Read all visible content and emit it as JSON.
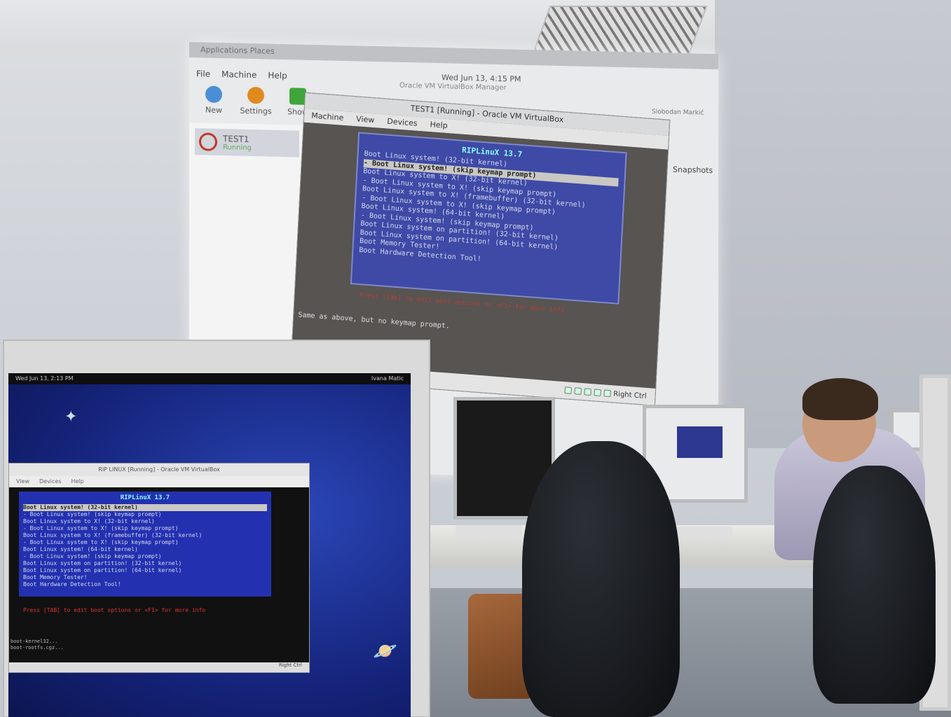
{
  "projection": {
    "topbar": "Applications   Places",
    "clock": "Wed Jun 13,  4:15 PM",
    "manager_title": "Oracle VM VirtualBox Manager",
    "user": "Slobodan Markić",
    "menu": [
      "File",
      "Machine",
      "Help"
    ],
    "toolbar": [
      {
        "label": "New",
        "color": "#4a8fd6"
      },
      {
        "label": "Settings",
        "color": "#e08a1e"
      },
      {
        "label": "Show",
        "color": "#3fa53a"
      }
    ],
    "vm_item": {
      "name": "TEST1",
      "state": "Running"
    },
    "snapshots_label": "Snapshots",
    "vm_window": {
      "title": "TEST1 [Running] - Oracle VM VirtualBox",
      "menu": [
        "Machine",
        "View",
        "Devices",
        "Help"
      ],
      "boot_title": "RIPLinuX 13.7",
      "boot_items": [
        "Boot Linux system! (32-bit kernel)",
        "- Boot Linux system! (skip keymap prompt)",
        "Boot Linux system to X! (32-bit kernel)",
        "- Boot Linux system to X! (skip keymap prompt)",
        "Boot Linux system to X! (framebuffer) (32-bit kernel)",
        "- Boot Linux system to X! (skip keymap prompt)",
        "Boot Linux system! (64-bit kernel)",
        "- Boot Linux system! (skip keymap prompt)",
        "Boot Linux system on partition! (32-bit kernel)",
        "Boot Linux system on partition! (64-bit kernel)",
        "Boot Memory Tester!",
        "Boot Hardware Detection Tool!"
      ],
      "selected_index": 1,
      "hint": "Press [Tab] to edit boot options or <F1> for more info",
      "description": "Same as above, but no keymap prompt.",
      "host_key": "Right Ctrl"
    }
  },
  "front_monitor": {
    "clock": "Wed Jun 13,  2:13 PM",
    "user": "Ivana Matic",
    "vm_title": "RIP LINUX [Running] - Oracle VM VirtualBox",
    "menu": [
      "View",
      "Devices",
      "Help"
    ],
    "boot_title": "RIPLinuX 13.7",
    "boot_items": [
      "Boot Linux system! (32-bit kernel)",
      "- Boot Linux system! (skip keymap prompt)",
      "Boot Linux system to X! (32-bit kernel)",
      "- Boot Linux system to X! (skip keymap prompt)",
      "Boot Linux system to X! (framebuffer) (32-bit kernel)",
      "- Boot Linux system to X! (skip keymap prompt)",
      "Boot Linux system! (64-bit kernel)",
      "- Boot Linux system! (skip keymap prompt)",
      "Boot Linux system on partition! (32-bit kernel)",
      "Boot Linux system on partition! (64-bit kernel)",
      "Boot Memory Tester!",
      "Boot Hardware Detection Tool!"
    ],
    "selected_index": 0,
    "hint": "Press [TAB] to edit boot options or <F1> for more info",
    "log": [
      "boot-kernel32...",
      "boot-rootfs.cgz..."
    ],
    "host_key": "Right Ctrl"
  }
}
